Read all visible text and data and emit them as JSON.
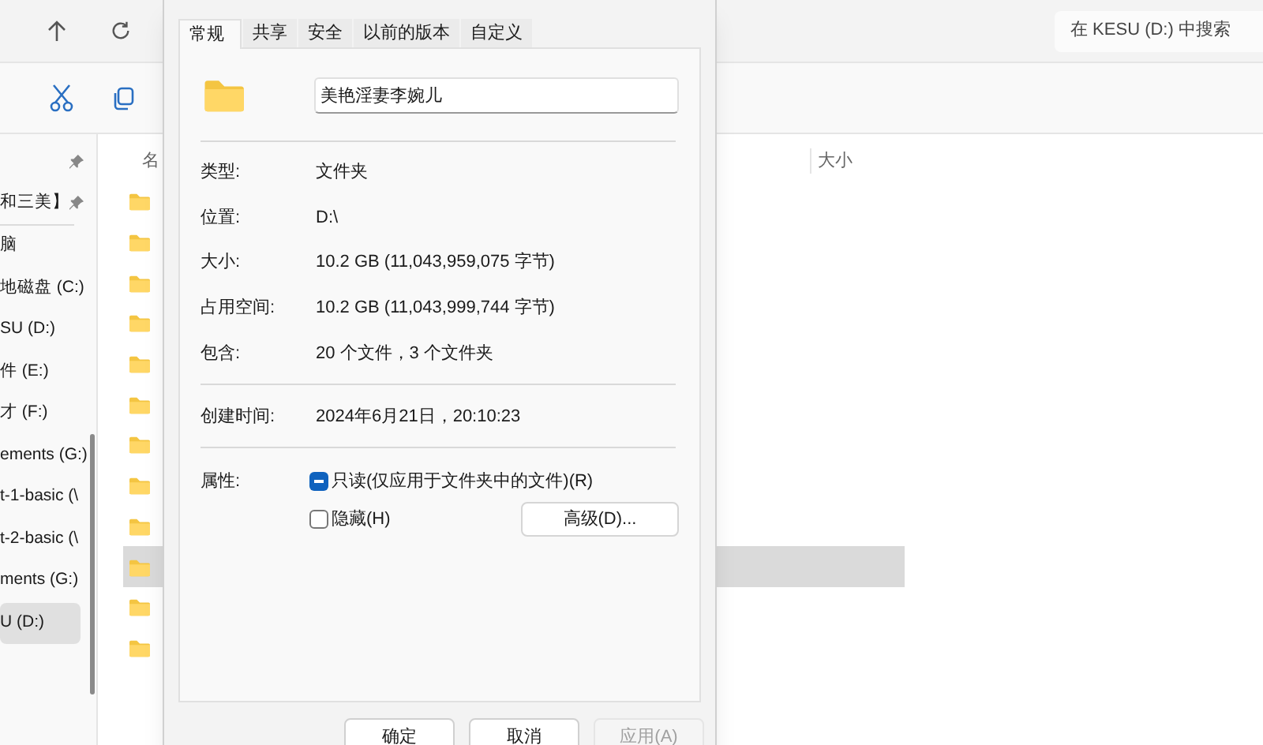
{
  "explorer": {
    "search": {
      "placeholder": "在 KESU (D:) 中搜索"
    },
    "sidebar": {
      "pinned_items": [
        {
          "selected": false
        },
        {
          "label": "和三美】",
          "selected": false
        }
      ],
      "items": [
        {
          "label": "脑",
          "selected": false
        },
        {
          "label": "地磁盘 (C:)",
          "selected": false
        },
        {
          "label": "SU (D:)",
          "selected": false
        },
        {
          "label": "件 (E:)",
          "selected": false
        },
        {
          "label": "才 (F:)",
          "selected": false
        },
        {
          "label": "ements (G:)",
          "selected": false
        },
        {
          "label": "t-1-basic (\\",
          "selected": false
        },
        {
          "label": "t-2-basic (\\",
          "selected": false
        },
        {
          "label": "ments (G:)",
          "selected": false
        },
        {
          "label": "U (D:)",
          "selected": true
        }
      ]
    },
    "columns": [
      "名",
      "大小"
    ],
    "rows": [
      {
        "selected": false
      },
      {
        "selected": false
      },
      {
        "selected": false
      },
      {
        "selected": false
      },
      {
        "selected": false
      },
      {
        "selected": false
      },
      {
        "selected": false
      },
      {
        "selected": false
      },
      {
        "selected": false
      },
      {
        "selected": true
      },
      {
        "selected": false
      },
      {
        "selected": false
      }
    ]
  },
  "dialog": {
    "tabs": [
      {
        "label": "常规",
        "selected": true
      },
      {
        "label": "共享",
        "selected": false
      },
      {
        "label": "安全",
        "selected": false
      },
      {
        "label": "以前的版本",
        "selected": false
      },
      {
        "label": "自定义",
        "selected": false
      }
    ],
    "name_field": {
      "value": "美艳淫妻李婉儿"
    },
    "groups": [
      [
        {
          "label": "类型:",
          "value": "文件夹"
        },
        {
          "label": "位置:",
          "value": "D:\\"
        },
        {
          "label": "大小:",
          "value": "10.2 GB (11,043,959,075 字节)"
        },
        {
          "label": "占用空间:",
          "value": "10.2 GB (11,043,999,744 字节)"
        },
        {
          "label": "包含:",
          "value": "20 个文件，3 个文件夹"
        }
      ],
      [
        {
          "label": "创建时间:",
          "value": "2024年6月21日，20:10:23"
        }
      ]
    ],
    "attributes": {
      "label": "属性:",
      "checkboxes": [
        {
          "label": "只读(仅应用于文件夹中的文件)(R)",
          "checked": true,
          "indeterminate": true
        },
        {
          "label": "隐藏(H)",
          "checked": false,
          "indeterminate": false
        }
      ],
      "advanced_button": "高级(D)..."
    },
    "buttons": [
      {
        "label": "确定",
        "disabled": false
      },
      {
        "label": "取消",
        "disabled": false
      },
      {
        "label": "应用(A)",
        "disabled": true
      }
    ]
  }
}
